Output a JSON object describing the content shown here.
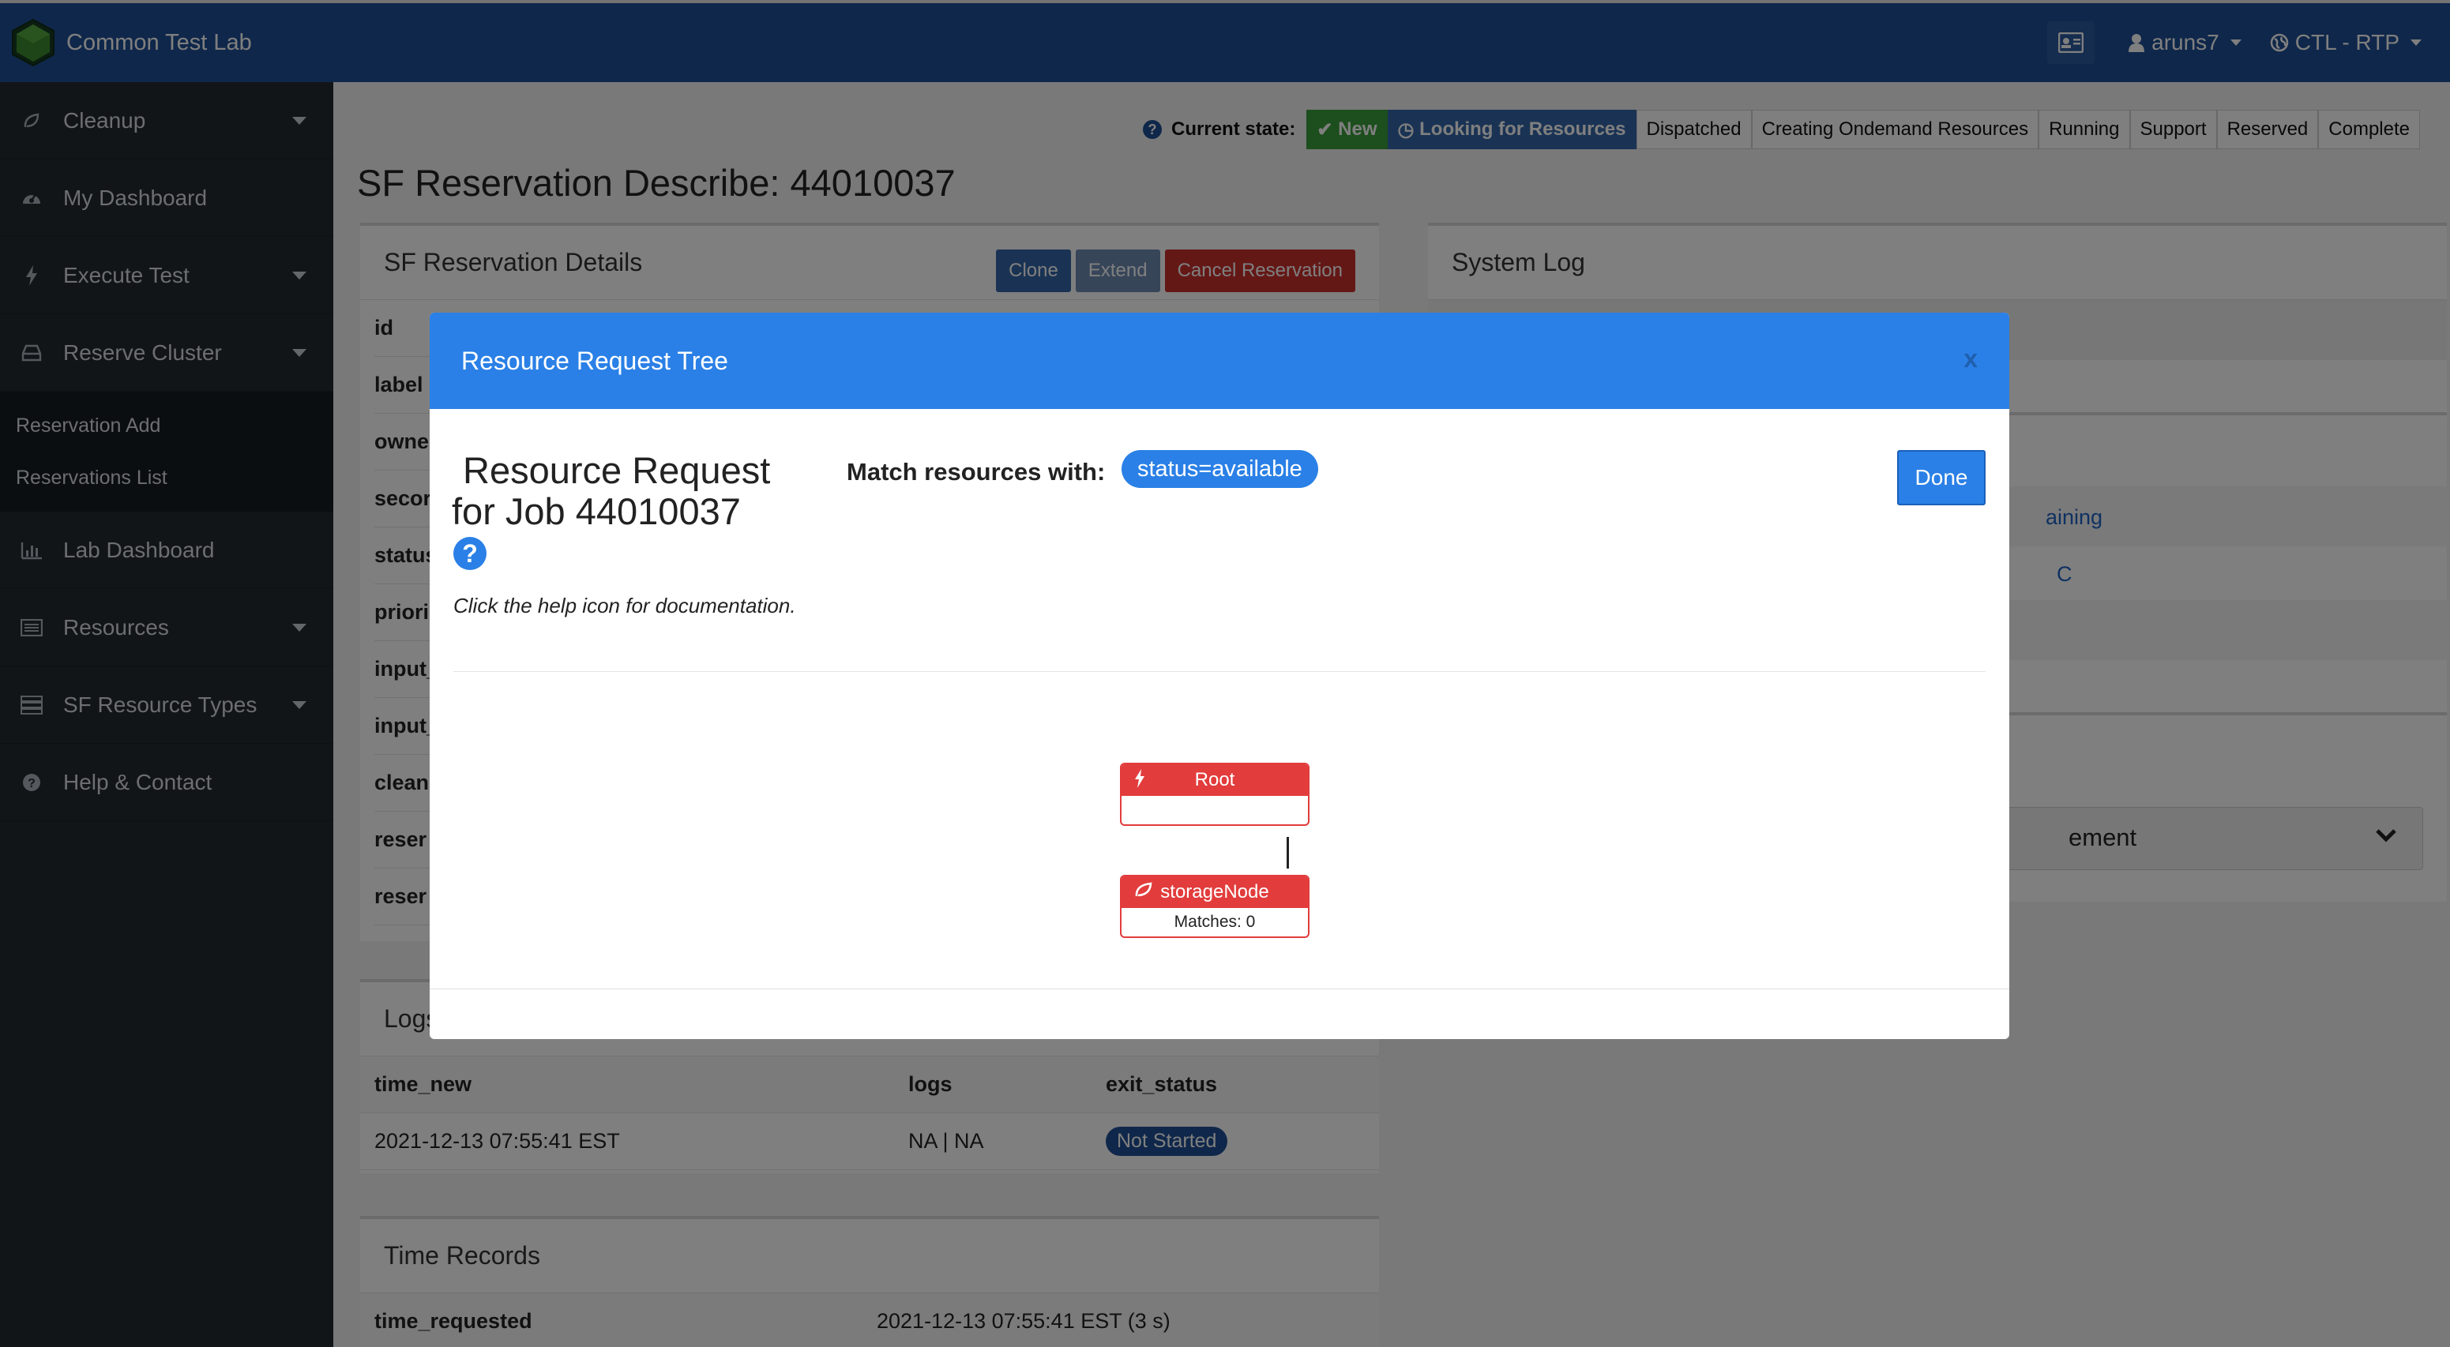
{
  "app": {
    "name": "Common Test Lab"
  },
  "topbar": {
    "user": "aruns7",
    "location": "CTL - RTP"
  },
  "sidebar": {
    "items": [
      {
        "label": "Cleanup",
        "icon": "leaf-icon",
        "has_caret": true
      },
      {
        "label": "My Dashboard",
        "icon": "dashboard-icon",
        "has_caret": false
      },
      {
        "label": "Execute Test",
        "icon": "bolt-icon",
        "has_caret": true
      },
      {
        "label": "Reserve Cluster",
        "icon": "inbox-icon",
        "has_caret": true
      }
    ],
    "sub_items": [
      {
        "label": "Reservation Add"
      },
      {
        "label": "Reservations List"
      }
    ],
    "items_after": [
      {
        "label": "Lab Dashboard",
        "icon": "bar-chart-icon",
        "has_caret": false
      },
      {
        "label": "Resources",
        "icon": "list-icon",
        "has_caret": true
      },
      {
        "label": "SF Resource Types",
        "icon": "server-icon",
        "has_caret": true
      },
      {
        "label": "Help & Contact",
        "icon": "question-icon",
        "has_caret": false
      }
    ]
  },
  "state": {
    "label": "Current state:",
    "steps": [
      {
        "label": "New",
        "status": "done"
      },
      {
        "label": "Looking for Resources",
        "status": "active"
      },
      {
        "label": "Dispatched",
        "status": "pending"
      },
      {
        "label": "Creating Ondemand Resources",
        "status": "pending"
      },
      {
        "label": "Running",
        "status": "pending"
      },
      {
        "label": "Support",
        "status": "pending"
      },
      {
        "label": "Reserved",
        "status": "pending"
      },
      {
        "label": "Complete",
        "status": "pending"
      }
    ]
  },
  "page": {
    "title": "SF Reservation Describe: 44010037"
  },
  "details": {
    "title": "SF Reservation Details",
    "buttons": {
      "clone": "Clone",
      "extend": "Extend",
      "cancel": "Cancel Reservation"
    },
    "row_labels": [
      "id",
      "label",
      "owne",
      "secor",
      "status",
      "priori",
      "input_",
      "input_",
      "clean",
      "reser",
      "reser"
    ]
  },
  "system_log": {
    "title": "System Log",
    "link1": "aining",
    "link2": "C",
    "select_text": "ement"
  },
  "logs": {
    "title": "Logs",
    "columns": [
      "time_new",
      "logs",
      "exit_status"
    ],
    "rows": [
      {
        "time_new": "2021-12-13 07:55:41 EST",
        "logs": "NA | NA",
        "exit_status": "Not Started"
      }
    ]
  },
  "time_records": {
    "title": "Time Records",
    "rows": [
      {
        "label": "time_requested",
        "value": "2021-12-13 07:55:41 EST (3 s)"
      }
    ]
  },
  "modal": {
    "header": "Resource Request Tree",
    "close": "x",
    "title_line1": "Resource Request",
    "title_line2": "for Job 44010037",
    "doc_text": "Click the help icon for documentation.",
    "match_label": "Match resources with:",
    "match_value": "status=available",
    "done": "Done",
    "tree": {
      "root": {
        "label": "Root",
        "icon": "bolt-icon"
      },
      "child": {
        "label": "storageNode",
        "icon": "leaf-icon",
        "matches": "Matches: 0"
      }
    }
  },
  "colors": {
    "navbar": "#1e4f94",
    "sidebar": "#222a30",
    "modal_header": "#2a80e6",
    "node_red": "#e23c3c",
    "state_done": "#3a9d3a",
    "state_active": "#3466a8"
  }
}
